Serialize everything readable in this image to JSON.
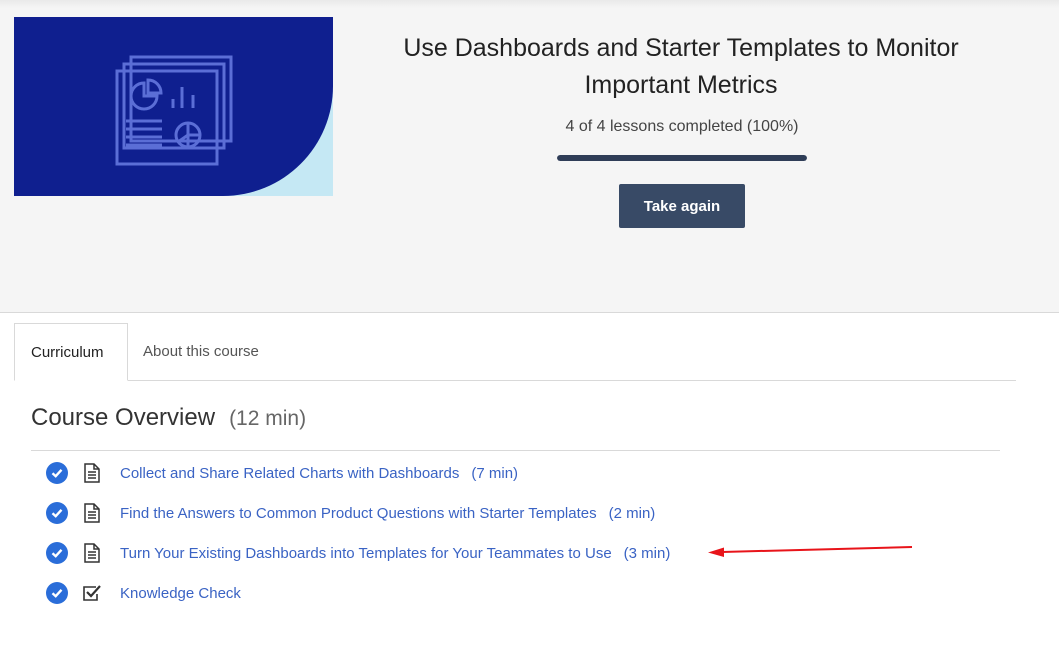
{
  "course": {
    "title": "Use Dashboards and Starter Templates to Monitor Important Metrics",
    "progress_text": "4 of 4 lessons completed (100%)",
    "progress_fraction": 1.0,
    "take_again_label": "Take again",
    "image_icon": "dashboard-charts-icon"
  },
  "tabs": [
    {
      "label": "Curriculum",
      "active": true
    },
    {
      "label": "About this course",
      "active": false
    }
  ],
  "overview": {
    "title": "Course Overview",
    "duration": "(12 min)",
    "lessons": [
      {
        "title": "Collect and Share Related Charts with Dashboards",
        "duration": "(7 min)",
        "type_icon": "document-icon",
        "completed": true
      },
      {
        "title": "Find the Answers to Common Product Questions with Starter Templates",
        "duration": "(2 min)",
        "type_icon": "document-icon",
        "completed": true
      },
      {
        "title": "Turn Your Existing Dashboards into Templates for Your Teammates to Use",
        "duration": "(3 min)",
        "type_icon": "document-icon",
        "completed": true
      },
      {
        "title": "Knowledge Check",
        "duration": "",
        "type_icon": "checkbox-icon",
        "completed": true
      }
    ]
  },
  "colors": {
    "image_navy": "#0f1f8f",
    "image_light_blue": "#c5e8f4",
    "button_bg": "#384a66",
    "progress_fill": "#2f3d57",
    "link_blue": "#3a63c4",
    "check_blue": "#2a6dd9",
    "annotation_red": "#e8141a"
  }
}
